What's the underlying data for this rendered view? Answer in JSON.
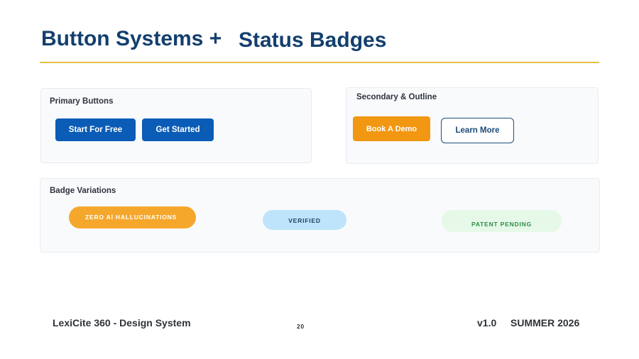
{
  "slide": {
    "title_part_1": "Button Systems +",
    "title_part_2": "Status Badges",
    "accent_color": "#E6BF47",
    "title_color": "#133F6E"
  },
  "primary_buttons": {
    "label": "Primary Buttons",
    "buttons": [
      {
        "label": "Start For Free",
        "color": "#0B5CB6"
      },
      {
        "label": "Get Started",
        "color": "#0B5CB6"
      }
    ]
  },
  "secondary_buttons": {
    "label": "Secondary & Outline",
    "buttons": [
      {
        "label": "Book A Demo",
        "color": "#F29711"
      },
      {
        "label": "Learn More",
        "color": "#1F4E7C"
      }
    ]
  },
  "badges": {
    "label": "Badge Variations",
    "items": [
      {
        "label": "ZERO AI HALLUCINATIONS",
        "bg": "#F5A72C",
        "fg": "#FFFFFF"
      },
      {
        "label": "VERIFIED",
        "bg": "#BDE4FA",
        "fg": "#1E4266"
      },
      {
        "label": "PATENT PENDING",
        "bg": "#E6F9E8",
        "fg": "#2E8B47"
      }
    ]
  },
  "footer": {
    "left": "LexiCite 360 - Design System",
    "page": "20",
    "version": "v1.0",
    "season": "SUMMER 2026"
  }
}
